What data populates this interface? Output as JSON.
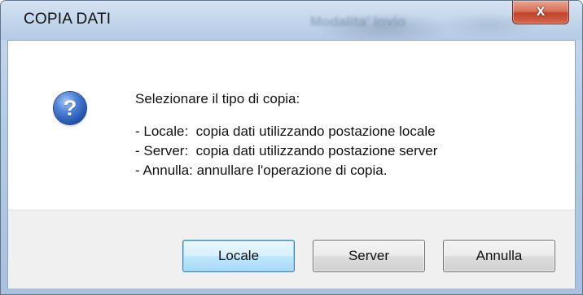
{
  "window": {
    "title": "COPIA DATI",
    "background_title": "Modalita' invio",
    "close_glyph": "x"
  },
  "dialog": {
    "icon": "question-icon",
    "lines": [
      "Selezionare il tipo di copia:",
      "- Locale:  copia dati utilizzando postazione locale",
      "- Server:  copia dati utilizzando postazione server",
      "- Annulla: annullare l'operazione di copia."
    ]
  },
  "buttons": {
    "locale": "Locale",
    "server": "Server",
    "annulla": "Annulla"
  },
  "colors": {
    "titlebar": "#c3d6eb",
    "close_button": "#c2412a",
    "default_button_border": "#3c7fb1",
    "footer": "#f0f0f0"
  }
}
